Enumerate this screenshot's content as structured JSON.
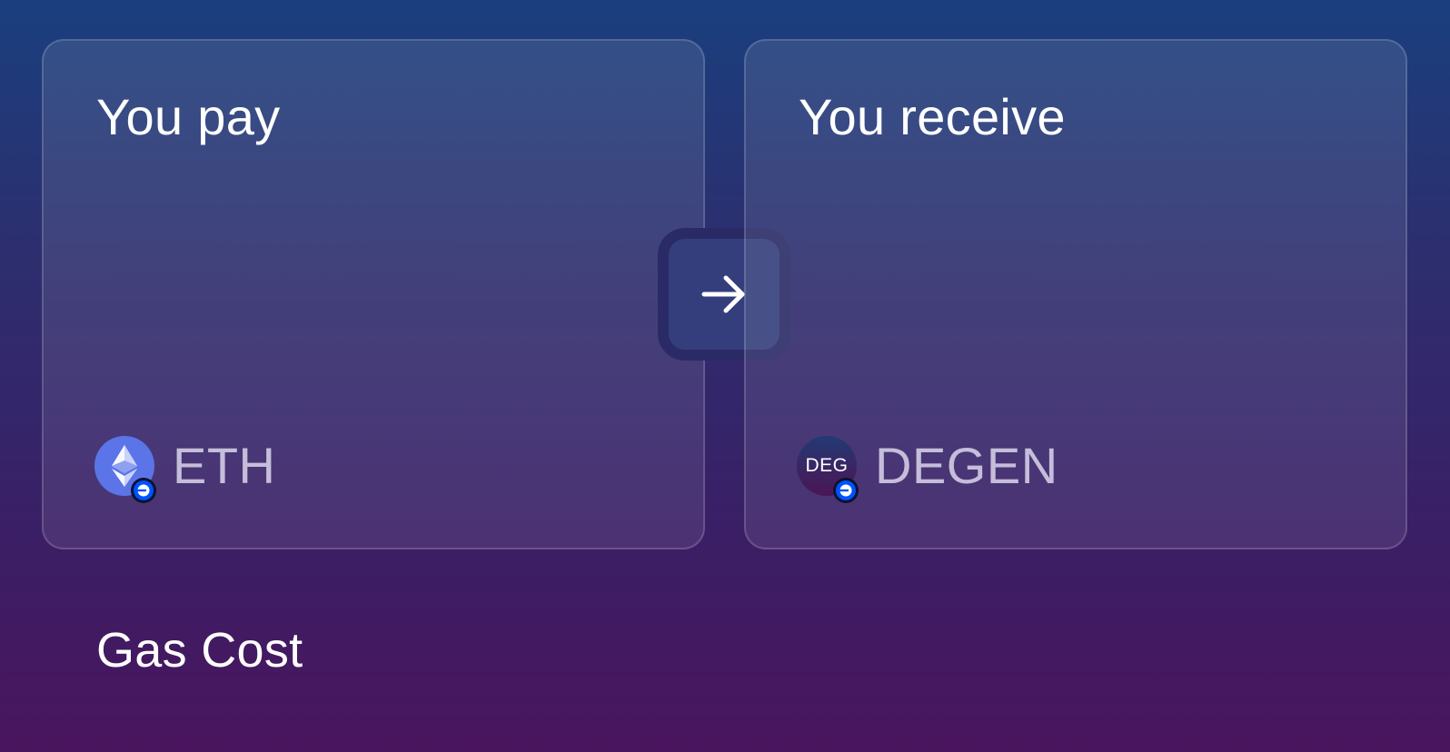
{
  "pay": {
    "title": "You pay",
    "token_symbol": "ETH",
    "token_icon": "ethereum-icon",
    "chain_badge_icon": "base-chain-icon"
  },
  "receive": {
    "title": "You receive",
    "token_symbol": "DEGEN",
    "token_icon_text": "DEG",
    "chain_badge_icon": "base-chain-icon"
  },
  "swap": {
    "icon": "arrow-right-icon"
  },
  "gas": {
    "label": "Gas Cost"
  },
  "colors": {
    "background_top": "#1a3f7e",
    "background_bottom": "#4a155e",
    "eth_icon": "#5b74e8",
    "chain_badge": "#0052ff"
  }
}
